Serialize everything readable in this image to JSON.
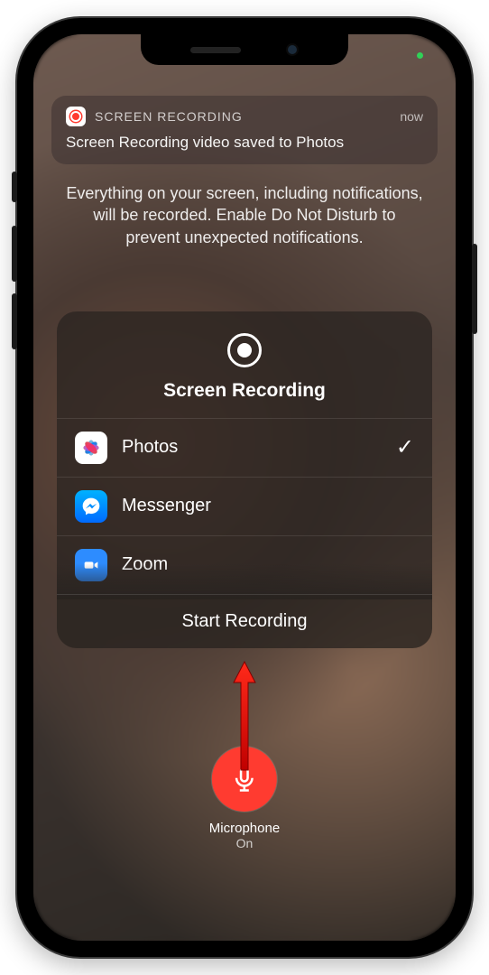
{
  "notification": {
    "app_name": "SCREEN RECORDING",
    "timestamp": "now",
    "message": "Screen Recording video saved to Photos"
  },
  "info_text": "Everything on your screen, including notifications, will be recorded. Enable Do Not Disturb to prevent unexpected notifications.",
  "card": {
    "title": "Screen Recording",
    "apps": [
      {
        "name": "Photos",
        "icon": "photos-icon",
        "selected": true
      },
      {
        "name": "Messenger",
        "icon": "messenger-icon",
        "selected": false
      },
      {
        "name": "Zoom",
        "icon": "zoom-icon",
        "selected": false
      }
    ],
    "start_label": "Start Recording"
  },
  "microphone": {
    "label": "Microphone",
    "state": "On"
  },
  "checkmark_glyph": "✓"
}
